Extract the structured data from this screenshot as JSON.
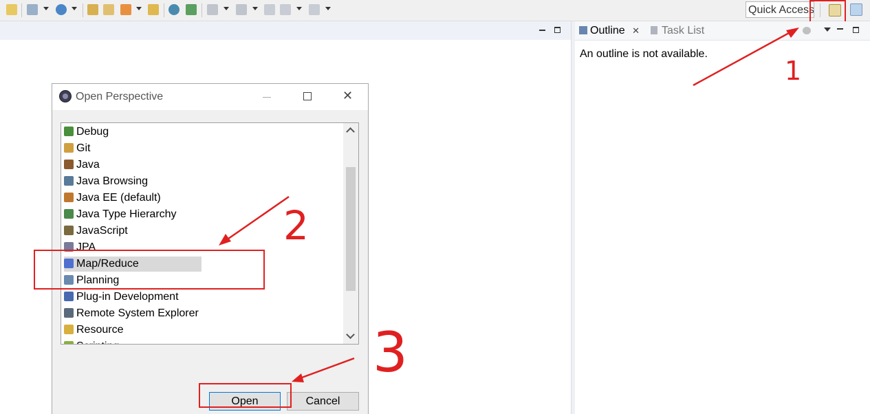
{
  "toolbar": {
    "quick_access_label": "Quick Access",
    "icons": [
      "new-wizard-icon",
      "new-project-icon",
      "new-server-icon",
      "open-type-icon",
      "open-task-icon",
      "run-icon",
      "open-folder-icon",
      "globe-icon",
      "refresh-icon",
      "next-annotation-icon",
      "previous-annotation-icon",
      "last-edit-location-icon",
      "back-icon",
      "forward-icon"
    ]
  },
  "outline_view": {
    "tab_outline": "Outline",
    "tab_task_list": "Task List",
    "message": "An outline is not available."
  },
  "dialog": {
    "title": "Open Perspective",
    "perspectives": [
      {
        "label": "Debug",
        "icon": "debug-icon",
        "color": "#4a8f3c"
      },
      {
        "label": "Git",
        "icon": "git-icon",
        "color": "#d0a040"
      },
      {
        "label": "Java",
        "icon": "java-icon",
        "color": "#8a5a2e"
      },
      {
        "label": "Java Browsing",
        "icon": "java-browsing-icon",
        "color": "#5a7a9a"
      },
      {
        "label": "Java EE (default)",
        "icon": "java-ee-icon",
        "color": "#c07830"
      },
      {
        "label": "Java Type Hierarchy",
        "icon": "type-hierarchy-icon",
        "color": "#4a8a4a"
      },
      {
        "label": "JavaScript",
        "icon": "javascript-icon",
        "color": "#7a6a40"
      },
      {
        "label": "JPA",
        "icon": "jpa-icon",
        "color": "#7a7a9a"
      },
      {
        "label": "Map/Reduce",
        "icon": "elephant-icon",
        "color": "#5070d0"
      },
      {
        "label": "Planning",
        "icon": "clock-icon",
        "color": "#6a8ab0"
      },
      {
        "label": "Plug-in Development",
        "icon": "plugin-icon",
        "color": "#4a6ab0"
      },
      {
        "label": "Remote System Explorer",
        "icon": "remote-system-icon",
        "color": "#5a6a7a"
      },
      {
        "label": "Resource",
        "icon": "folder-icon",
        "color": "#d8b040"
      },
      {
        "label": "Scripting",
        "icon": "scripting-icon",
        "color": "#8ab040"
      }
    ],
    "selected_index": 8,
    "open_label": "Open",
    "cancel_label": "Cancel"
  },
  "annotations": {
    "step1": "1",
    "step2": "2",
    "step3": "3",
    "color": "#e02020"
  }
}
